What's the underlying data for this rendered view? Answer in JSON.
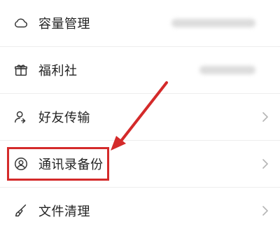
{
  "menu": {
    "items": [
      {
        "label": "容量管理",
        "icon": "cloud-icon"
      },
      {
        "label": "福利社",
        "icon": "gift-icon"
      },
      {
        "label": "好友传输",
        "icon": "friend-transfer-icon"
      },
      {
        "label": "通讯录备份",
        "icon": "contact-icon"
      },
      {
        "label": "文件清理",
        "icon": "broom-icon"
      }
    ]
  },
  "annotation": {
    "color": "#d42a2a",
    "highlighted_item": "通讯录备份"
  }
}
